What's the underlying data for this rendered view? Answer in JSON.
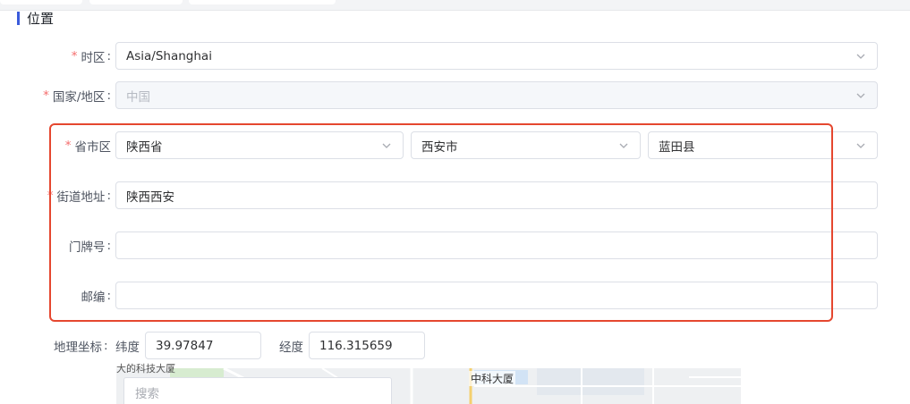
{
  "section": {
    "title": "位置"
  },
  "form": {
    "timezone": {
      "label": "时区",
      "required": true,
      "value": "Asia/Shanghai"
    },
    "country": {
      "label": "国家/地区",
      "required": true,
      "value": "中国",
      "disabled": true
    },
    "region": {
      "label": "省市区",
      "required": true,
      "province": "陕西省",
      "city": "西安市",
      "district": "蓝田县"
    },
    "street": {
      "label": "街道地址",
      "required": true,
      "value": "陕西西安"
    },
    "door_number": {
      "label": "门牌号",
      "required": false,
      "value": ""
    },
    "postcode": {
      "label": "邮编",
      "required": false,
      "value": ""
    },
    "geo": {
      "label": "地理坐标",
      "lat_label": "纬度",
      "lat_value": "39.97847",
      "lng_label": "经度",
      "lng_value": "116.315659"
    }
  },
  "map": {
    "search_placeholder": "搜索",
    "poi_label": "中科大厦",
    "poi_label_partial": "大的科技大厦"
  },
  "colors": {
    "accent_bar": "#3b5bdb",
    "required_star": "#f56c6c",
    "highlight_box": "#e5472f"
  },
  "icons": {
    "select_arrow": "chevron-down-icon"
  }
}
